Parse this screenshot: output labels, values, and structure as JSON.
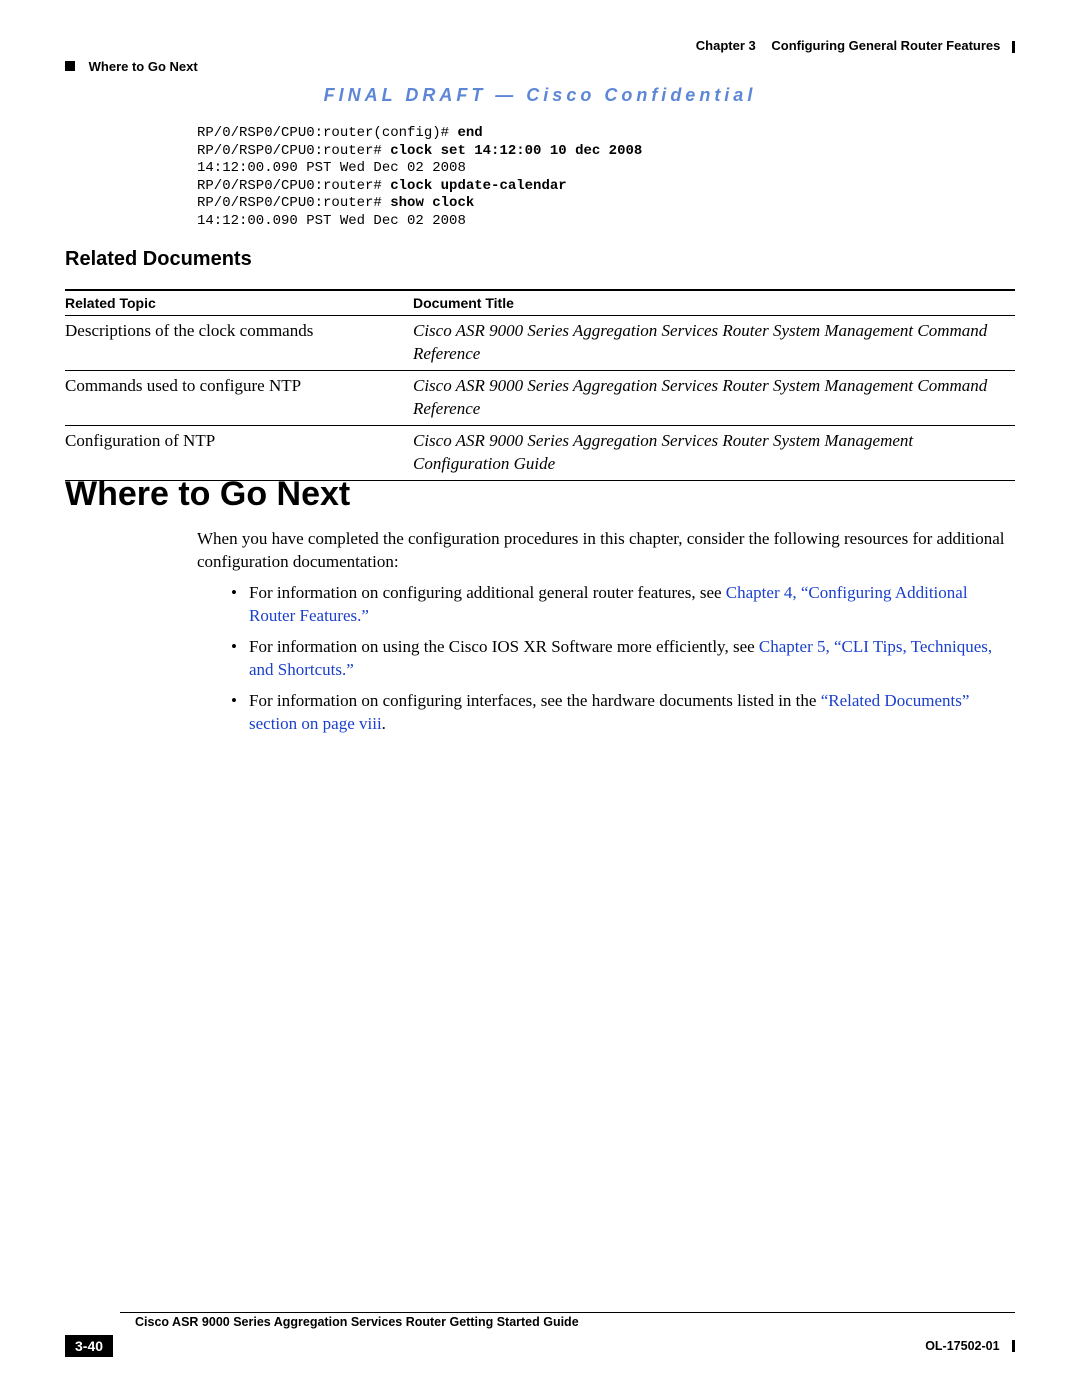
{
  "header": {
    "chapter_label": "Chapter 3",
    "chapter_title": "Configuring General Router Features",
    "section_crumb": "Where to Go Next"
  },
  "banner": "FINAL DRAFT — Cisco Confidential",
  "terminal": {
    "l1_prompt": "RP/0/RSP0/CPU0:router(config)# ",
    "l1_cmd": "end",
    "l2_prompt": "RP/0/RSP0/CPU0:router# ",
    "l2_cmd": "clock set 14:12:00 10 dec 2008",
    "l3": "14:12:00.090 PST Wed Dec 02 2008",
    "l4_prompt": "RP/0/RSP0/CPU0:router# ",
    "l4_cmd": "clock update-calendar",
    "l5_prompt": "RP/0/RSP0/CPU0:router# ",
    "l5_cmd": "show clock",
    "l6": "14:12:00.090 PST Wed Dec 02 2008"
  },
  "related_docs": {
    "heading": "Related Documents",
    "col_topic": "Related Topic",
    "col_doc": "Document Title",
    "rows": [
      {
        "topic": "Descriptions of the clock commands",
        "doc": "Cisco ASR 9000 Series Aggregation Services Router System Management Command Reference"
      },
      {
        "topic": "Commands used to configure NTP",
        "doc": "Cisco ASR 9000 Series Aggregation Services Router System Management Command Reference"
      },
      {
        "topic": "Configuration of NTP",
        "doc": "Cisco ASR 9000 Series Aggregation Services Router System Management Configuration Guide"
      }
    ]
  },
  "where_next": {
    "heading": "Where to Go Next",
    "intro": "When you have completed the configuration procedures in this chapter, consider the following resources for additional configuration documentation:",
    "b1_pre": "For information on configuring additional general router features, see ",
    "b1_link": "Chapter 4, “Configuring Additional Router Features.”",
    "b2_pre": "For information on using the Cisco IOS XR Software more efficiently, see ",
    "b2_link": "Chapter 5, “CLI Tips, Techniques, and Shortcuts.”",
    "b3_pre": "For information on configuring interfaces, see the hardware documents listed in the ",
    "b3_link": "“Related Documents” section on page viii",
    "b3_post": "."
  },
  "footer": {
    "guide_title": "Cisco ASR 9000 Series Aggregation Services Router Getting Started Guide",
    "page_num": "3-40",
    "doc_id": "OL-17502-01"
  }
}
